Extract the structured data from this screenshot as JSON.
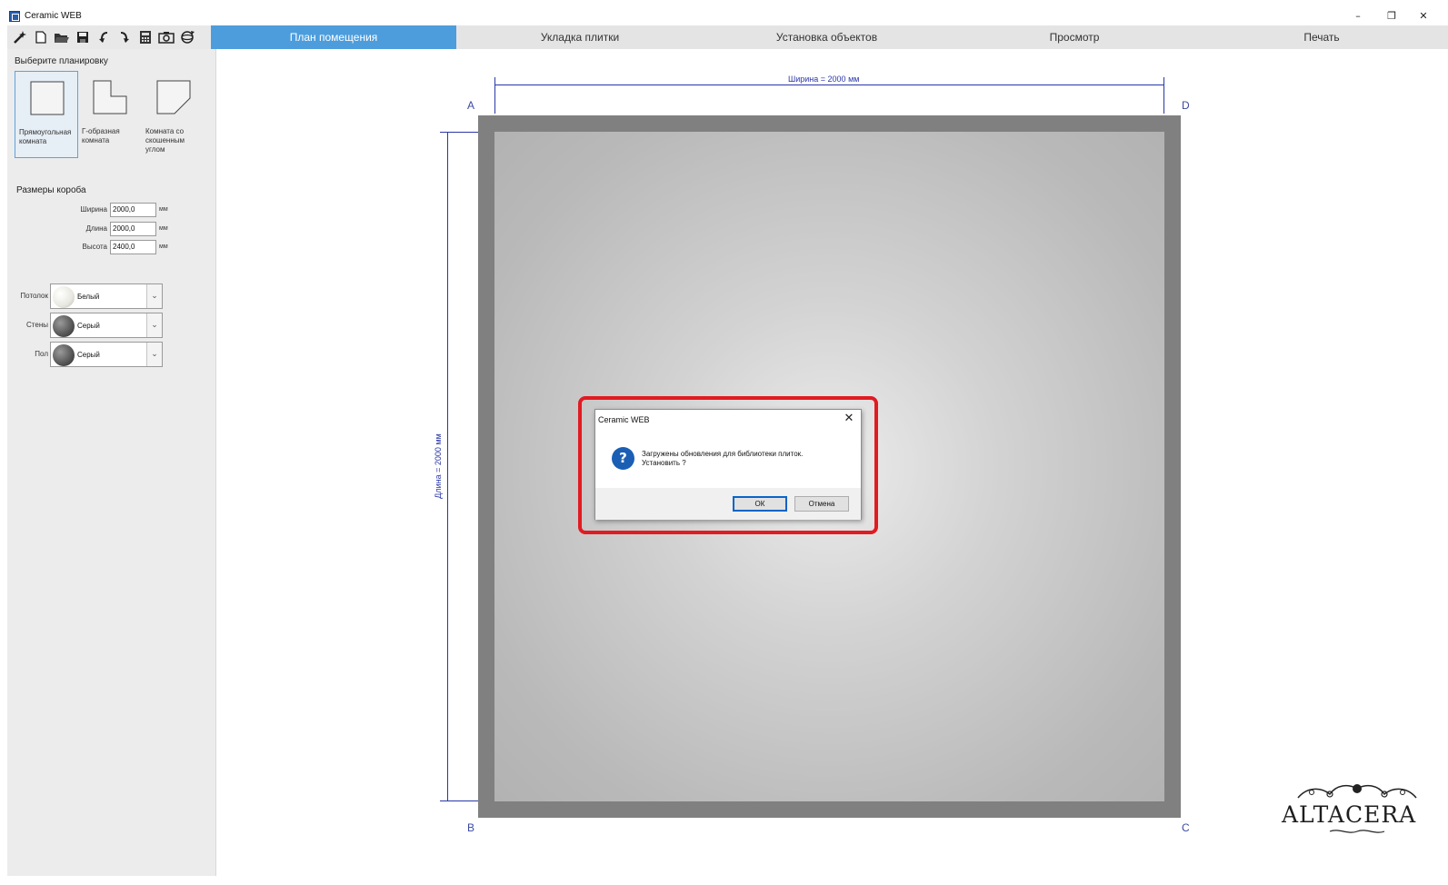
{
  "window": {
    "title": "Ceramic WEB"
  },
  "toolbar": {
    "icons": [
      "wand-icon",
      "new-file-icon",
      "open-folder-icon",
      "save-icon",
      "undo-icon",
      "redo-icon",
      "calculator-icon",
      "camera-icon",
      "rotate-3d-icon"
    ]
  },
  "tabs": [
    "План помещения",
    "Укладка плитки",
    "Установка объектов",
    "Просмотр",
    "Печать"
  ],
  "active_tab": "План помещения",
  "left_panel": {
    "layout_title": "Выберите планировку",
    "layouts": [
      {
        "label": "Прямоугольная комната",
        "selected": true
      },
      {
        "label": "Г-образная комната",
        "selected": false
      },
      {
        "label": "Комната со скошенным углом",
        "selected": false
      }
    ],
    "box_title": "Размеры короба",
    "dimensions": [
      {
        "label": "Ширина",
        "value": "2000,0",
        "unit": "мм"
      },
      {
        "label": "Длина",
        "value": "2000,0",
        "unit": "мм"
      },
      {
        "label": "Высота",
        "value": "2400,0",
        "unit": "мм"
      }
    ],
    "materials": [
      {
        "label": "Потолок",
        "value": "Белый",
        "color": "#efefe9"
      },
      {
        "label": "Стены",
        "value": "Серый",
        "color": "#555555"
      },
      {
        "label": "Пол",
        "value": "Серый",
        "color": "#555555"
      }
    ]
  },
  "plan": {
    "width_caption": "Ширина = 2000 мм",
    "length_caption": "Длина = 2000 мм",
    "corners": {
      "a": "A",
      "b": "B",
      "c": "C",
      "d": "D"
    }
  },
  "dialog": {
    "title": "Ceramic WEB",
    "line1": "Загружены обновления для библиотеки плиток.",
    "line2": "Установить ?",
    "ok_label": "ОК",
    "cancel_label": "Отмена"
  },
  "logo": {
    "text": "ALTACERA"
  }
}
